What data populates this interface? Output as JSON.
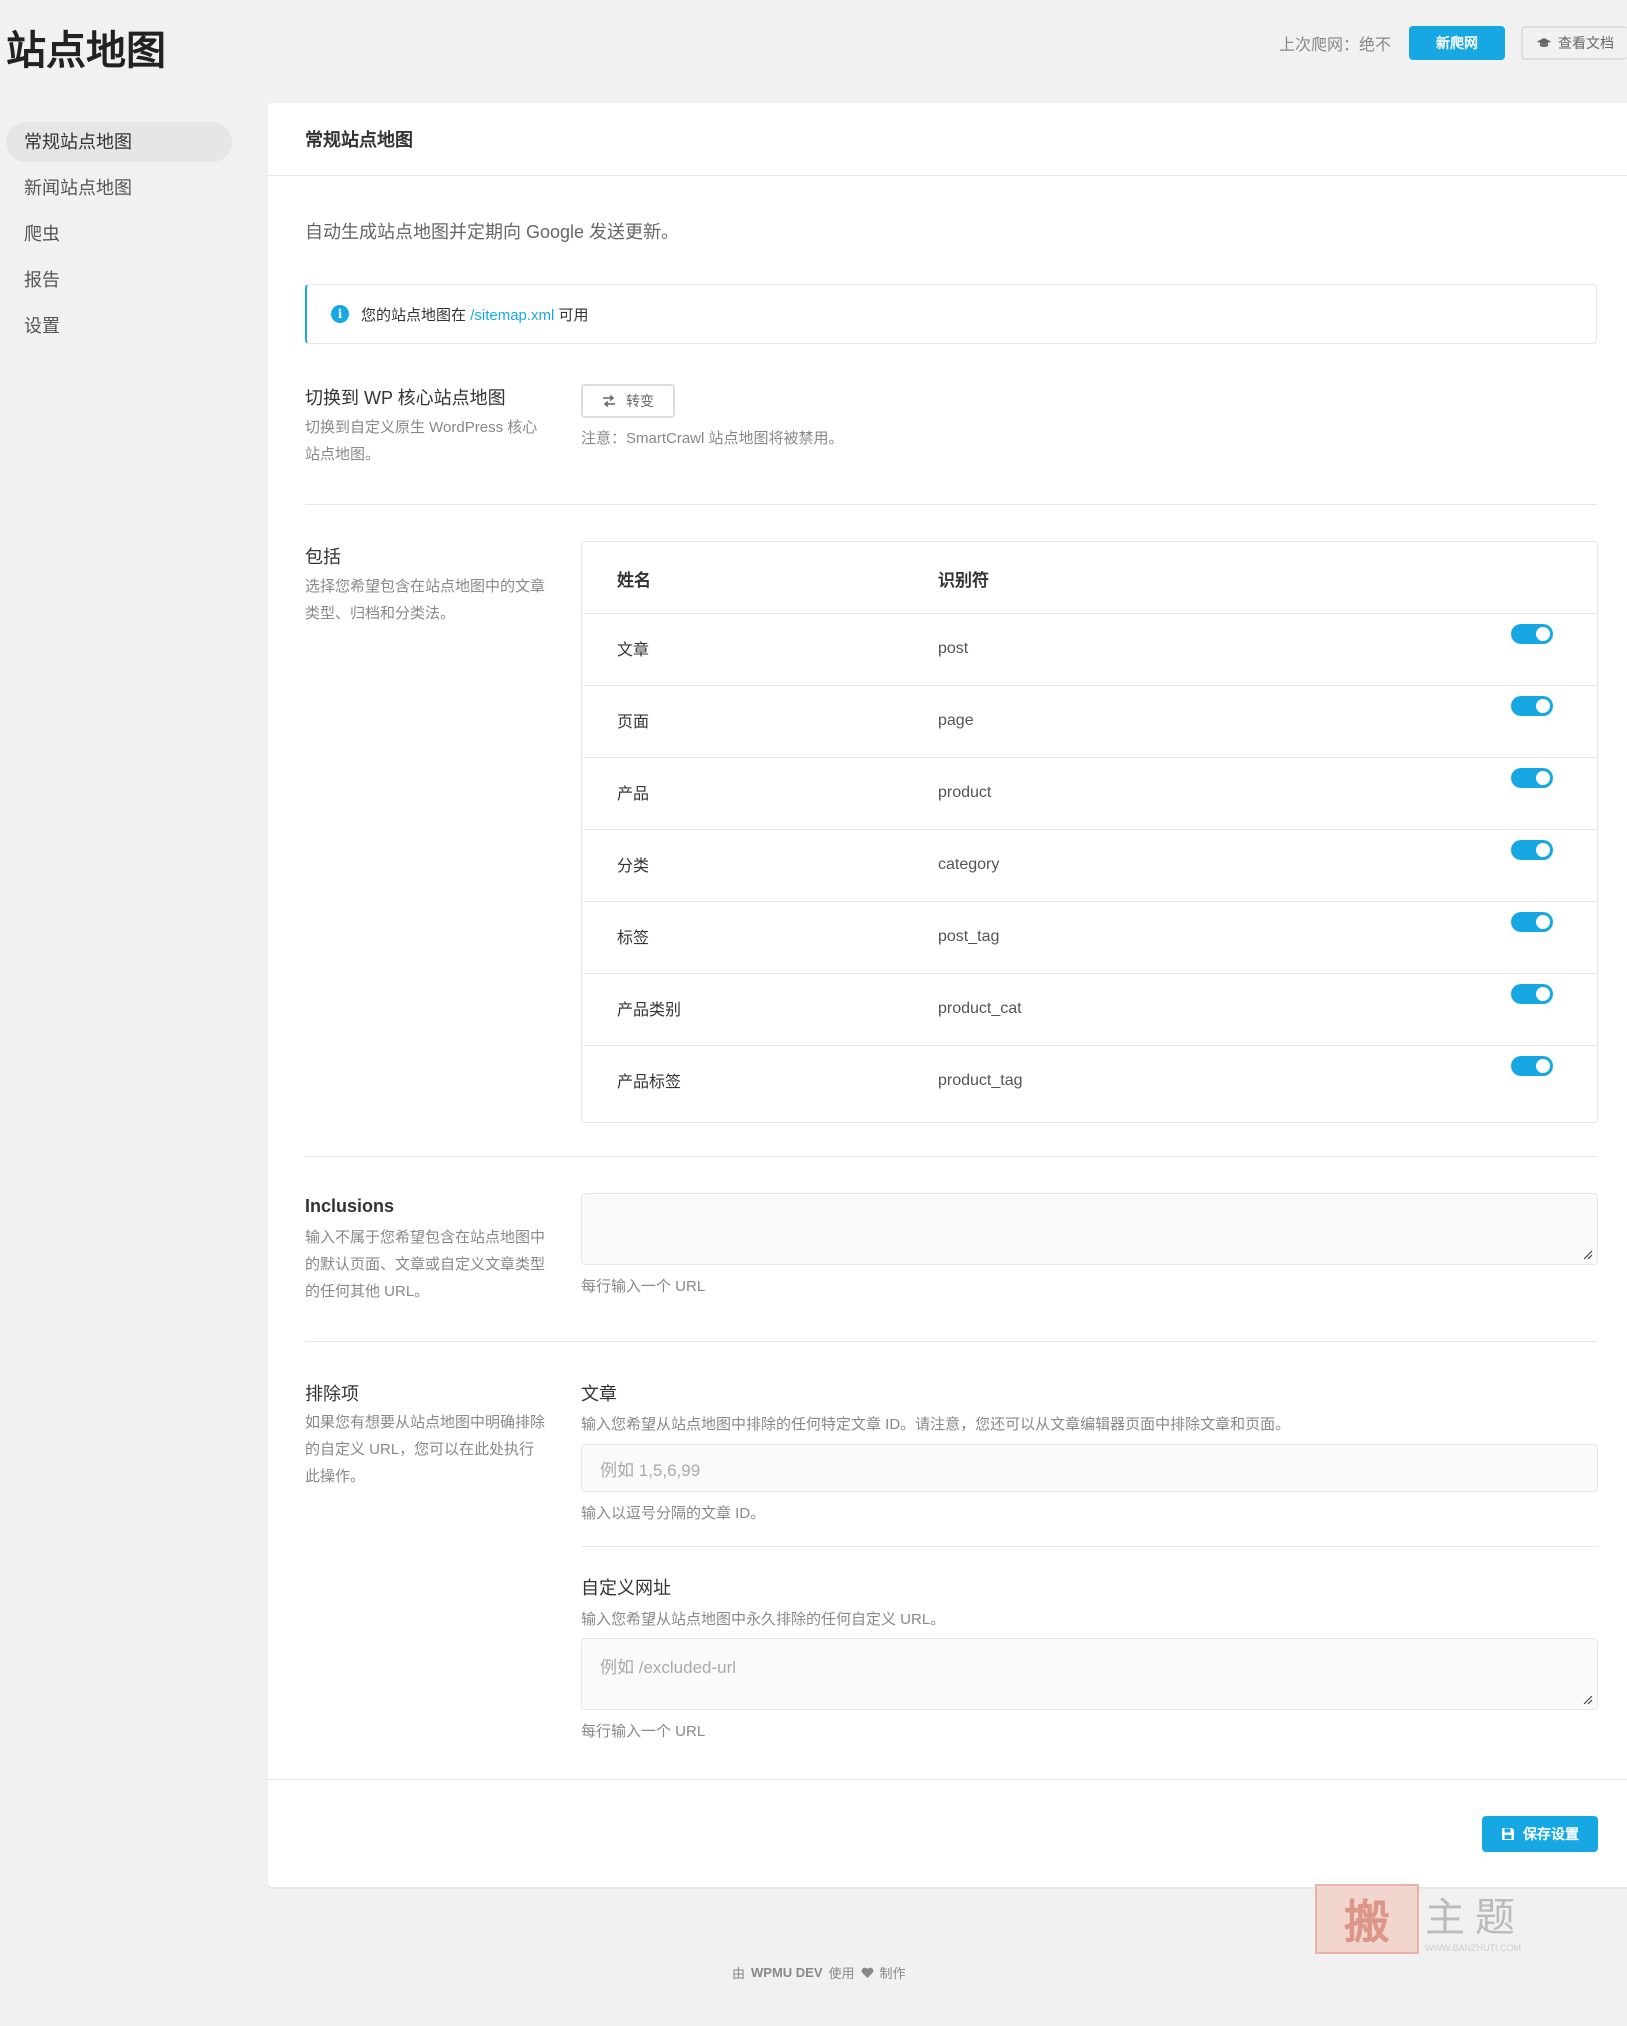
{
  "page": {
    "title": "站点地图"
  },
  "header": {
    "last_crawl": "上次爬网：绝不",
    "new_crawl_label": "新爬网",
    "docs_label": "查看文档"
  },
  "sidebar": {
    "items": [
      {
        "label": "常规站点地图",
        "active": true
      },
      {
        "label": "新闻站点地图"
      },
      {
        "label": "爬虫"
      },
      {
        "label": "报告"
      },
      {
        "label": "设置"
      }
    ]
  },
  "card": {
    "title": "常规站点地图",
    "intro": "自动生成站点地图并定期向 Google 发送更新。",
    "notice": {
      "prefix": "您的站点地图在",
      "link": "/sitemap.xml",
      "suffix": "可用"
    },
    "switch_section": {
      "label": "切换到 WP 核心站点地图",
      "desc": "切换到自定义原生 WordPress 核心站点地图。",
      "button": "转变",
      "note": "注意：SmartCrawl 站点地图将被禁用。"
    },
    "include_section": {
      "label": "包括",
      "desc": "选择您希望包含在站点地图中的文章类型、归档和分类法。",
      "columns": {
        "name": "姓名",
        "identifier": "识别符"
      },
      "rows": [
        {
          "name": "文章",
          "id": "post",
          "enabled": true
        },
        {
          "name": "页面",
          "id": "page",
          "enabled": true
        },
        {
          "name": "产品",
          "id": "product",
          "enabled": true
        },
        {
          "name": "分类",
          "id": "category",
          "enabled": true
        },
        {
          "name": "标签",
          "id": "post_tag",
          "enabled": true
        },
        {
          "name": "产品类别",
          "id": "product_cat",
          "enabled": true
        },
        {
          "name": "产品标签",
          "id": "product_tag",
          "enabled": true
        }
      ]
    },
    "inclusions_section": {
      "label": "Inclusions",
      "desc": "输入不属于您希望包含在站点地图中的默认页面、文章或自定义文章类型的任何其他 URL。",
      "value": "",
      "hint": "每行输入一个 URL"
    },
    "exclusions_section": {
      "label": "排除项",
      "desc": "如果您有想要从站点地图中明确排除的自定义 URL，您可以在此处执行此操作。",
      "posts": {
        "label": "文章",
        "desc": "输入您希望从站点地图中排除的任何特定文章 ID。请注意，您还可以从文章编辑器页面中排除文章和页面。",
        "placeholder": "例如 1,5,6,99",
        "hint": "输入以逗号分隔的文章 ID。"
      },
      "urls": {
        "label": "自定义网址",
        "desc": "输入您希望从站点地图中永久排除的任何自定义 URL。",
        "placeholder": "例如 /excluded-url",
        "hint": "每行输入一个 URL"
      }
    },
    "save_label": "保存设置"
  },
  "footer": {
    "credit_prefix": "由",
    "credit_brand": "WPMU DEV",
    "credit_mid": "使用",
    "credit_suffix": "制作"
  },
  "watermark": {
    "seal": "搬",
    "text": "主题",
    "url": "WWW.BANZHUTI.COM"
  },
  "colors": {
    "accent": "#17a8e3",
    "background": "#f1f1f1"
  }
}
